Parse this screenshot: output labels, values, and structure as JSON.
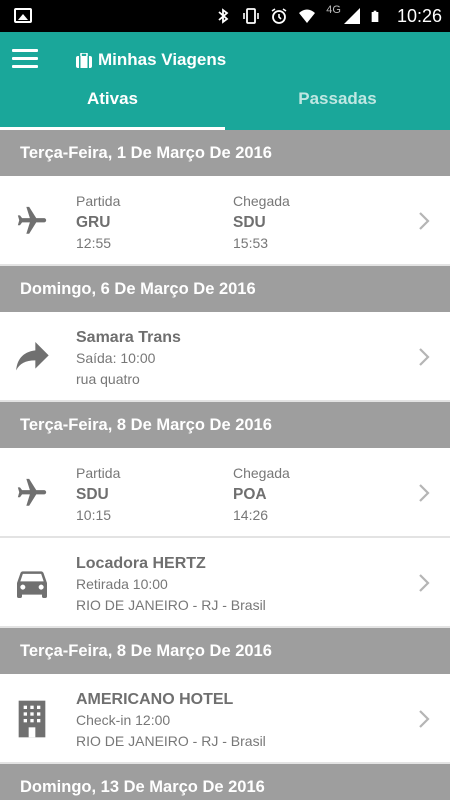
{
  "status_bar": {
    "time": "10:26",
    "network": "4G",
    "icons": [
      "image-icon",
      "bluetooth-icon",
      "vibrate-icon",
      "alarm-icon",
      "wifi-icon",
      "signal-icon",
      "battery-icon"
    ]
  },
  "app_bar": {
    "title": "Minhas Viagens",
    "menu_icon": "hamburger-menu-icon",
    "title_icon": "suitcase-icon",
    "color": "#1aa79a"
  },
  "tabs": [
    {
      "label": "Ativas",
      "active": true
    },
    {
      "label": "Passadas",
      "active": false
    }
  ],
  "sections": [
    {
      "date": "Terça-Feira, 1 De Março De 2016",
      "items": [
        {
          "type": "flight",
          "icon": "airplane-icon",
          "departure": {
            "label": "Partida",
            "code": "GRU",
            "time": "12:55"
          },
          "arrival": {
            "label": "Chegada",
            "code": "SDU",
            "time": "15:53"
          }
        }
      ]
    },
    {
      "date": "Domingo, 6 De Março De 2016",
      "items": [
        {
          "type": "transfer",
          "icon": "arrow-forward-icon",
          "title": "Samara Trans",
          "line1": "Saída: 10:00",
          "line2": "rua quatro"
        }
      ]
    },
    {
      "date": "Terça-Feira, 8 De Março De 2016",
      "items": [
        {
          "type": "flight",
          "icon": "airplane-icon",
          "departure": {
            "label": "Partida",
            "code": "SDU",
            "time": "10:15"
          },
          "arrival": {
            "label": "Chegada",
            "code": "POA",
            "time": "14:26"
          }
        },
        {
          "type": "car",
          "icon": "car-icon",
          "title": "Locadora HERTZ",
          "line1": "Retirada 10:00",
          "line2": "RIO DE JANEIRO - RJ - Brasil"
        }
      ]
    },
    {
      "date": "Terça-Feira, 8 De Março De 2016",
      "items": [
        {
          "type": "hotel",
          "icon": "hotel-building-icon",
          "title": "AMERICANO HOTEL",
          "line1": "Check-in 12:00",
          "line2": "RIO DE JANEIRO - RJ - Brasil"
        }
      ]
    },
    {
      "date": "Domingo, 13 De Março De 2016",
      "items": []
    }
  ]
}
